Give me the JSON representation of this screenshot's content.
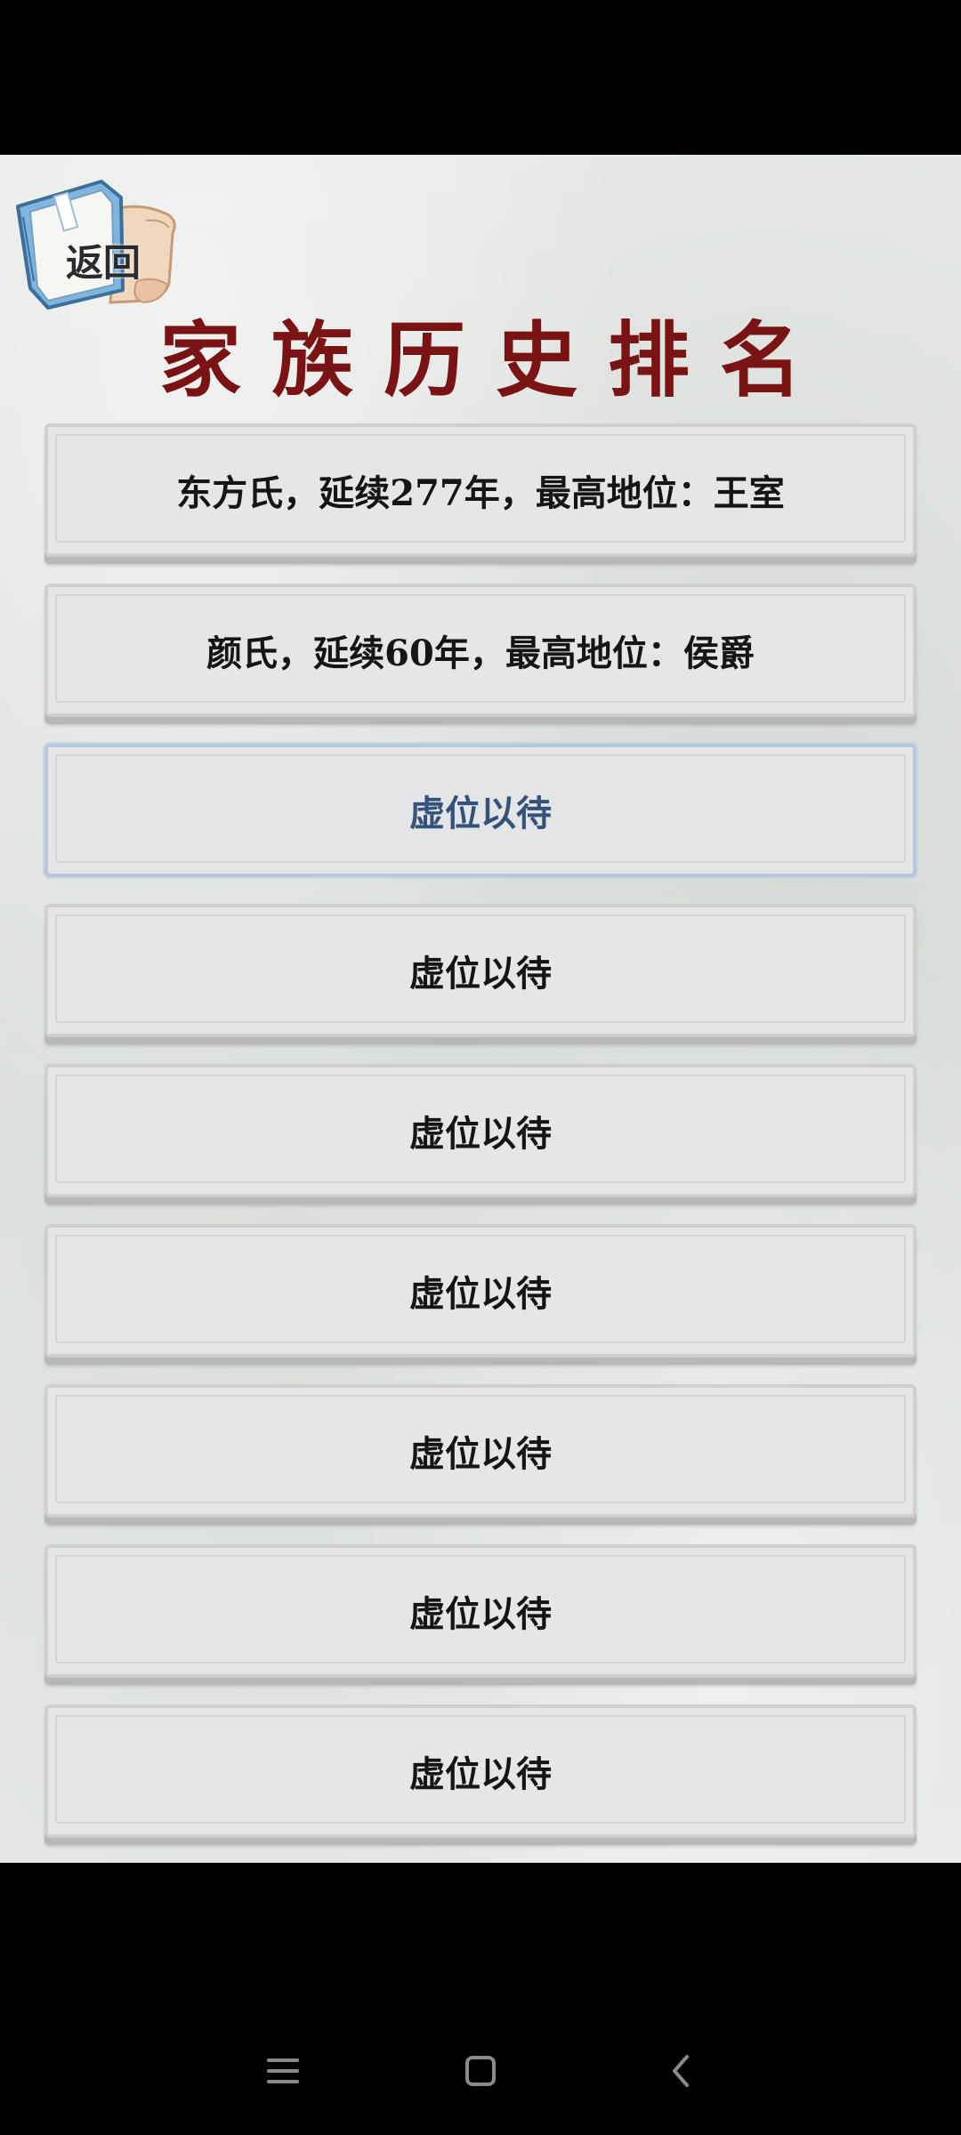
{
  "app": {
    "title": "家族历史排名"
  },
  "header": {
    "back_label": "返回"
  },
  "rankings": [
    {
      "text": "东方氏，延续277年，最高地位：王室",
      "selected": false
    },
    {
      "text": "颜氏，延续60年，最高地位：侯爵",
      "selected": false
    },
    {
      "text": "虚位以待",
      "selected": true
    },
    {
      "text": "虚位以待",
      "selected": false
    },
    {
      "text": "虚位以待",
      "selected": false
    },
    {
      "text": "虚位以待",
      "selected": false
    },
    {
      "text": "虚位以待",
      "selected": false
    },
    {
      "text": "虚位以待",
      "selected": false
    },
    {
      "text": "虚位以待",
      "selected": false
    }
  ],
  "navigation": {
    "icons": [
      "menu-icon",
      "home-icon",
      "back-arrow-icon"
    ]
  },
  "colors": {
    "title": "#7a1414",
    "selected_text": "#36517a",
    "card_bg": "#e6e6e6",
    "page_bg": "#e2e5e2"
  }
}
